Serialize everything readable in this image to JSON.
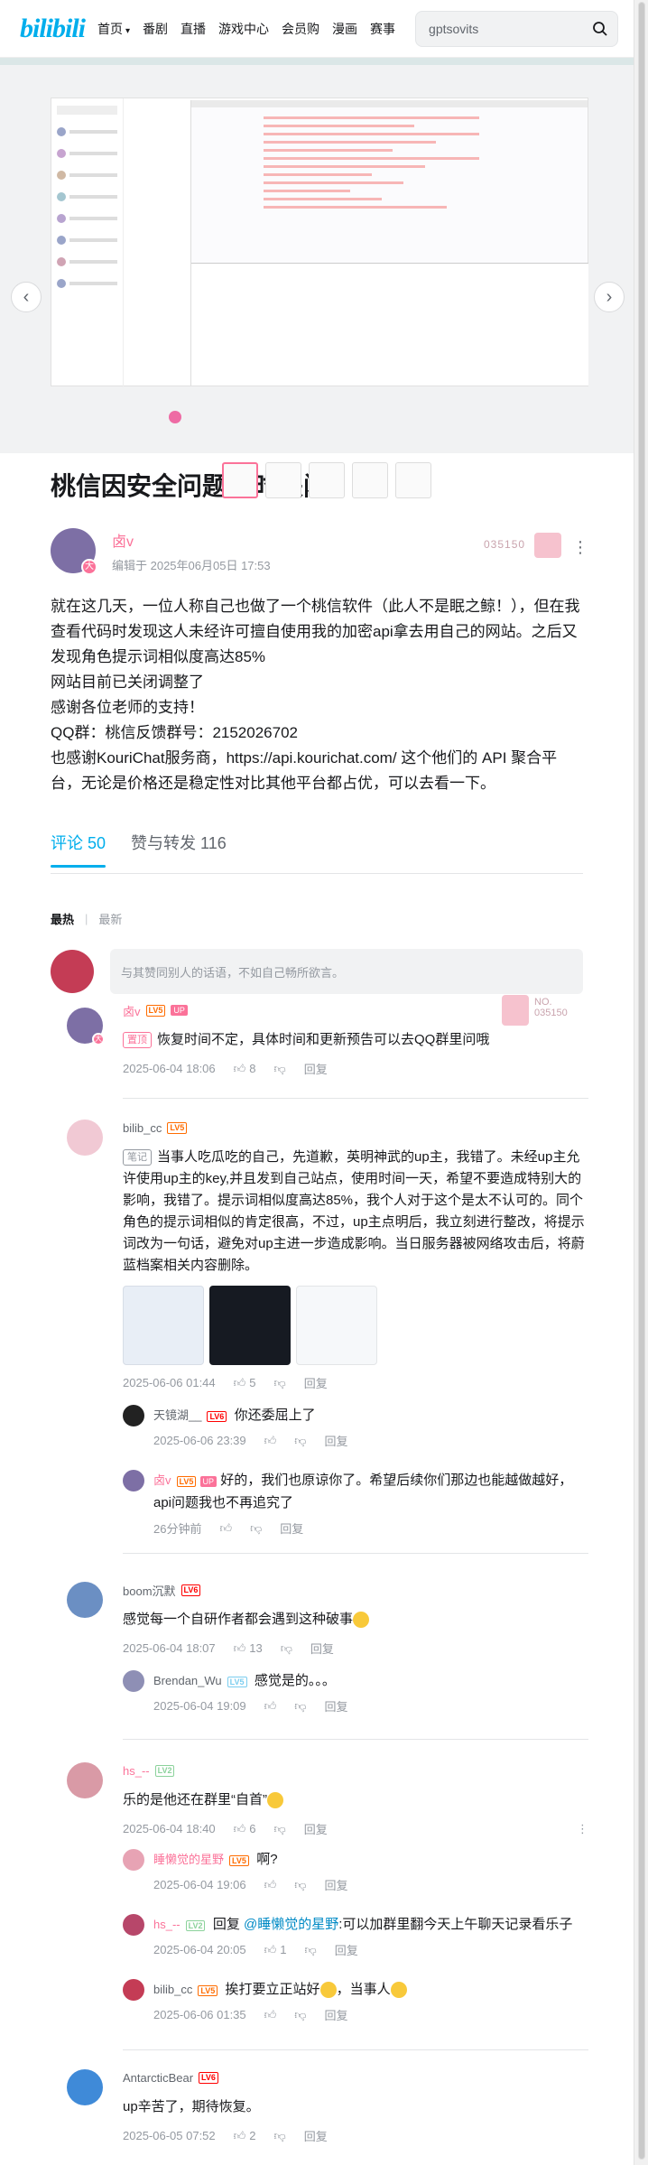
{
  "header": {
    "logo": "bilibili",
    "nav": [
      "首页",
      "番剧",
      "直播",
      "游戏中心",
      "会员购",
      "漫画",
      "赛事"
    ],
    "search_value": "gptsovits"
  },
  "article": {
    "title": "桃信因安全问题暂时关闭",
    "author": "卤v",
    "edited": "编辑于 2025年06月05日 17:53",
    "medal_no": "035150",
    "paragraphs": [
      "就在这几天，一位人称自己也做了一个桃信软件（此人不是眠之鲸！），但在我查看代码时发现这人未经许可擅自使用我的加密api拿去用自己的网站。之后又发现角色提示词相似度高达85%",
      "网站目前已关闭调整了",
      "感谢各位老师的支持！",
      "QQ群：桃信反馈群号：2152026702",
      "也感谢KouriChat服务商，https://api.kourichat.com/ 这个他们的 API 聚合平台，无论是价格还是稳定性对比其他平台都占优，可以去看一下。"
    ]
  },
  "tabs": {
    "comments": "评论 50",
    "likes": "赞与转发 116"
  },
  "sort": {
    "hot": "最热",
    "new": "最新"
  },
  "reply_placeholder": "与其赞同别人的话语，不如自己畅所欲言。",
  "comments": [
    {
      "name": "卤v",
      "level": "LV5",
      "up": "UP",
      "tag": "置顶",
      "text": "恢复时间不定，具体时间和更新预告可以去QQ群里问哦",
      "time": "2025-06-04 18:06",
      "likes": "8",
      "reply": "回复",
      "medal_label": "NO.",
      "medal_no": "035150"
    },
    {
      "name": "bilib_cc",
      "level": "LV5",
      "tag": "笔记",
      "text": "当事人吃瓜吃的自己，先道歉，英明神武的up主，我错了。未经up主允许使用up主的key,并且发到自己站点，使用时间一天，希望不要造成特别大的影响，我错了。提示词相似度高达85%，我个人对于这个是太不认可的。同个角色的提示词相似的肯定很高，不过，up主点明后，我立刻进行整改，将提示词改为一句话，避免对up主进一步造成影响。当日服务器被网络攻击后，将蔚蓝档案相关内容删除。",
      "time": "2025-06-06 01:44",
      "likes": "5",
      "reply": "回复",
      "subs": [
        {
          "name": "天镜湖__",
          "level": "LV6",
          "text": "你还委屈上了",
          "time": "2025-06-06 23:39",
          "reply": "回复"
        },
        {
          "name": "卤v",
          "level": "LV5",
          "up": "UP",
          "text": "好的，我们也原谅你了。希望后续你们那边也能越做越好，api问题我也不再追究了",
          "time": "26分钟前",
          "reply": "回复"
        }
      ]
    },
    {
      "name": "boom沉默",
      "level": "LV6",
      "text": "感觉每一个自研作者都会遇到这种破事",
      "time": "2025-06-04 18:07",
      "likes": "13",
      "reply": "回复",
      "subs": [
        {
          "name": "Brendan_Wu",
          "level": "LV5",
          "text": "感觉是的。。。",
          "time": "2025-06-04 19:09",
          "reply": "回复"
        }
      ]
    },
    {
      "name": "hs_--",
      "level": "LV2",
      "text": "乐的是他还在群里“自首”",
      "time": "2025-06-04 18:40",
      "likes": "6",
      "reply": "回复",
      "subs": [
        {
          "name": "睡懒觉的星野",
          "level": "LV5",
          "text": "啊?",
          "time": "2025-06-04 19:06",
          "reply": "回复"
        },
        {
          "name": "hs_--",
          "level": "LV2",
          "pre": "回复 ",
          "mention": "@睡懒觉的星野",
          "text": ":可以加群里翻今天上午聊天记录看乐子",
          "time": "2025-06-04 20:05",
          "likes": "1",
          "reply": "回复"
        },
        {
          "name": "bilib_cc",
          "level": "LV5",
          "text": "挨打要立正站好",
          "text2": "，当事人",
          "time": "2025-06-06 01:35",
          "reply": "回复"
        }
      ]
    },
    {
      "name": "AntarcticBear",
      "level": "LV6",
      "text": "up辛苦了，期待恢复。",
      "time": "2025-06-05 07:52",
      "likes": "2",
      "reply": "回复"
    }
  ]
}
